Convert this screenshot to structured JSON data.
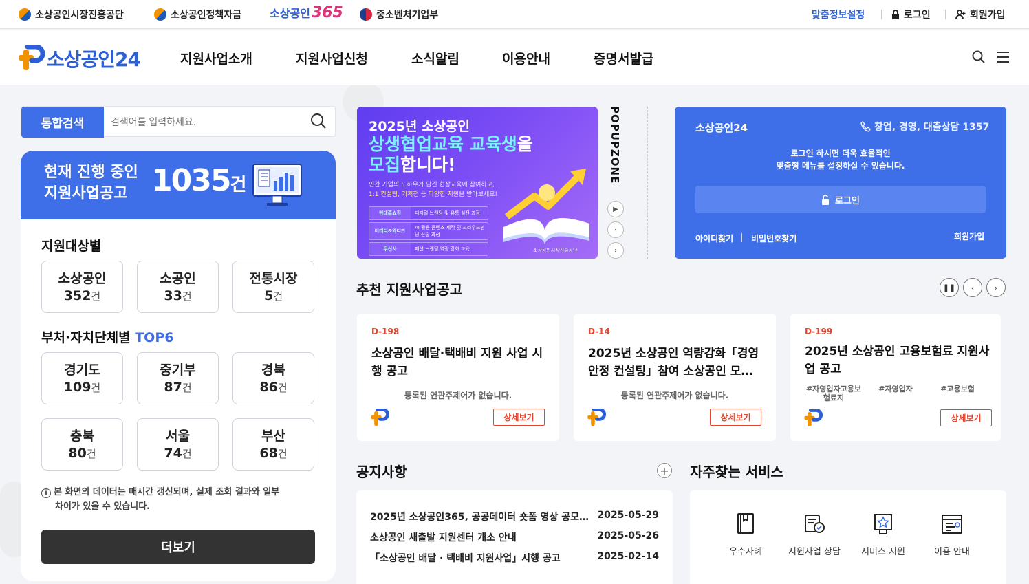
{
  "topbar": {
    "links": [
      {
        "label": "소상공인시장진흥공단",
        "icon": "semas-emblem-icon"
      },
      {
        "label": "소상공인정책자금",
        "icon": "semas-emblem-icon"
      },
      {
        "label": "소상공인365",
        "icon": "brand-logo"
      },
      {
        "label": "중소벤처기업부",
        "icon": "government-emblem-icon"
      }
    ],
    "custom_info": "맞춤정보설정",
    "login": "로그인",
    "signup": "회원가입",
    "brand365_prefix": "소상공인",
    "brand365_number": "365"
  },
  "header": {
    "logo_text": "소상공인24",
    "nav": [
      "지원사업소개",
      "지원사업신청",
      "소식알림",
      "이용안내",
      "증명서발급"
    ]
  },
  "search": {
    "tab_label": "통합검색",
    "placeholder": "검색어를 입력하세요."
  },
  "stats": {
    "label_line1": "현재 진행 중인",
    "label_line2": "지원사업공고",
    "count": "1035",
    "unit": "건",
    "target_title": "지원대상별",
    "target": [
      {
        "name": "소상공인",
        "count": "352"
      },
      {
        "name": "소공인",
        "count": "33"
      },
      {
        "name": "전통시장",
        "count": "5"
      }
    ],
    "agency_title_prefix": "부처·자치단체별",
    "agency_title_highlight": "TOP6",
    "agencies": [
      {
        "name": "경기도",
        "count": "109"
      },
      {
        "name": "중기부",
        "count": "87"
      },
      {
        "name": "경북",
        "count": "86"
      },
      {
        "name": "충북",
        "count": "80"
      },
      {
        "name": "서울",
        "count": "74"
      },
      {
        "name": "부산",
        "count": "68"
      }
    ],
    "unit_small": "건",
    "info_line1": "본 화면의 데이터는 매시간 갱신되며, 실제 조회 결과와 일부",
    "info_line2": "차이가 있을 수 있습니다.",
    "more_label": "더보기"
  },
  "banner": {
    "title1": "2025년 소상공인",
    "title2_highlight": "상생협업교육 교육생",
    "title2_suffix": "을",
    "title3_highlight": "모집",
    "title3_suffix": "합니다!",
    "sub1": "민간 기업의 노하우가 담긴 현장교육에 참여하고,",
    "sub2_highlight": "1:1 컨설팅, 기획전 등 다양한 지원",
    "sub2_suffix": "을 받아보세요!",
    "rows": [
      {
        "a": "현대홈쇼핑",
        "b": "디지털 브랜딩 및 유통 실전 과정"
      },
      {
        "a": "미리디&와디즈",
        "b": "AI 활용 콘텐츠 제작 및 크라우드펀딩 진출 과정"
      },
      {
        "a": "무신사",
        "b": "패션 브랜딩 역량 강화 교육"
      }
    ],
    "org": "소상공인시장진흥공단"
  },
  "popupzone": {
    "title": "POPUPZONE"
  },
  "login_box": {
    "title": "소상공인24",
    "phone": "창업, 경영, 대출상담 1357",
    "desc1": "로그인 하시면 더욱 효율적인",
    "desc2": "맞춤형 메뉴를 설정하실 수 있습니다.",
    "login_btn": "로그인",
    "find_id": "아이디찾기",
    "find_pw": "비밀번호찾기",
    "signup": "회원가입"
  },
  "recommended": {
    "title": "추천 지원사업공고",
    "detail_label": "상세보기",
    "cards": [
      {
        "dday": "D-198",
        "title": "소상공인 배달·택배비 지원 사업 시행 공고",
        "empty": "등록된 연관주제어가 없습니다."
      },
      {
        "dday": "D-14",
        "title": "2025년 소상공인 역량강화「경영안정 컨설팅」참여 소상공인 모…",
        "empty": "등록된 연관주제어가 없습니다."
      },
      {
        "dday": "D-199",
        "title": "2025년 소상공인 고용보험료 지원사업 공고",
        "tags": [
          "#자영업자고용보험료지",
          "#자영업자",
          "#고용보험"
        ]
      }
    ]
  },
  "notice": {
    "title": "공지사항",
    "items": [
      {
        "title": "2025년 소상공인365, 공공데이터 숏폼 영상 공모…",
        "date": "2025-05-29"
      },
      {
        "title": "소상공인 새출발 지원센터 개소 안내",
        "date": "2025-05-26"
      },
      {
        "title": "「소상공인 배달 · 택배비 지원사업」시행 공고",
        "date": "2025-02-14"
      }
    ]
  },
  "services": {
    "title": "자주찾는 서비스",
    "items": [
      {
        "label": "우수사례",
        "icon": "book-icon"
      },
      {
        "label": "지원사업 상담",
        "icon": "consult-icon"
      },
      {
        "label": "서비스 지원",
        "icon": "award-icon"
      },
      {
        "label": "이용 안내",
        "icon": "guide-icon"
      }
    ]
  },
  "colors": {
    "primary": "#3f6fe8",
    "accent": "#e8452d",
    "orange": "#f39200"
  }
}
